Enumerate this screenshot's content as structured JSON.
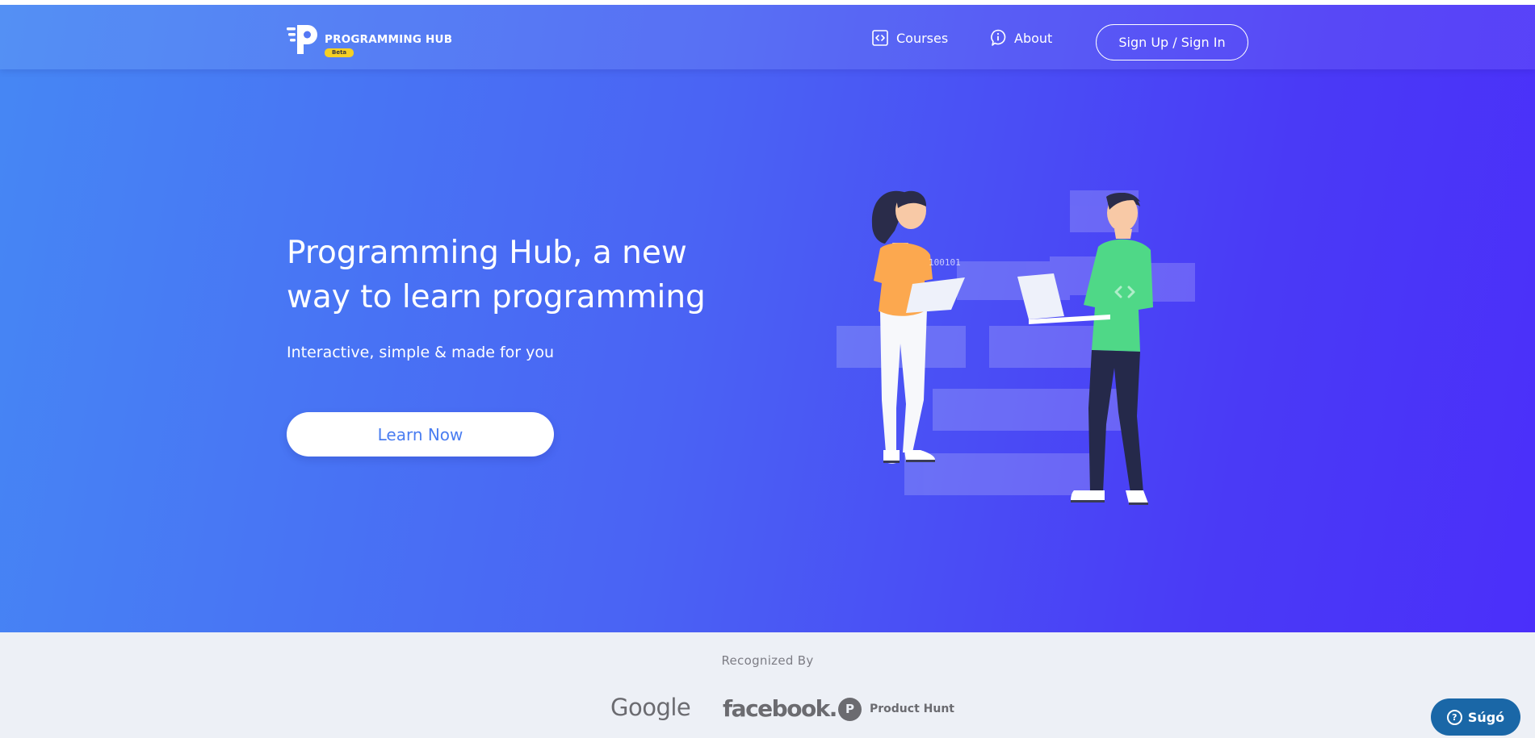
{
  "header": {
    "brand_name": "PROGRAMMING HUB",
    "beta_badge": "Beta",
    "nav": {
      "courses": "Courses",
      "about": "About"
    },
    "signin_label": "Sign Up / Sign In"
  },
  "hero": {
    "title": "Programming Hub, a new way to learn programming",
    "subtitle": "Interactive, simple & made for you",
    "cta_label": "Learn Now",
    "illustration": {
      "tablet_text": "100101"
    }
  },
  "recognized": {
    "label": "Recognized By",
    "logos": {
      "google": "Google",
      "facebook": "facebook.",
      "producthunt_mark": "P",
      "producthunt": "Product Hunt"
    }
  },
  "help": {
    "icon_glyph": "?",
    "label": "Súgó"
  },
  "colors": {
    "hero_gradient_start": "#4687f4",
    "hero_gradient_end": "#4b2ffa",
    "cta_text": "#4a7df1",
    "beta_badge": "#f5d023",
    "help_button": "#1a67a7",
    "recognized_bg": "#edf0f6"
  },
  "icons": {
    "courses": "code-square-icon",
    "about": "info-icon",
    "logo": "programming-hub-logo",
    "help": "question-circle-icon"
  }
}
